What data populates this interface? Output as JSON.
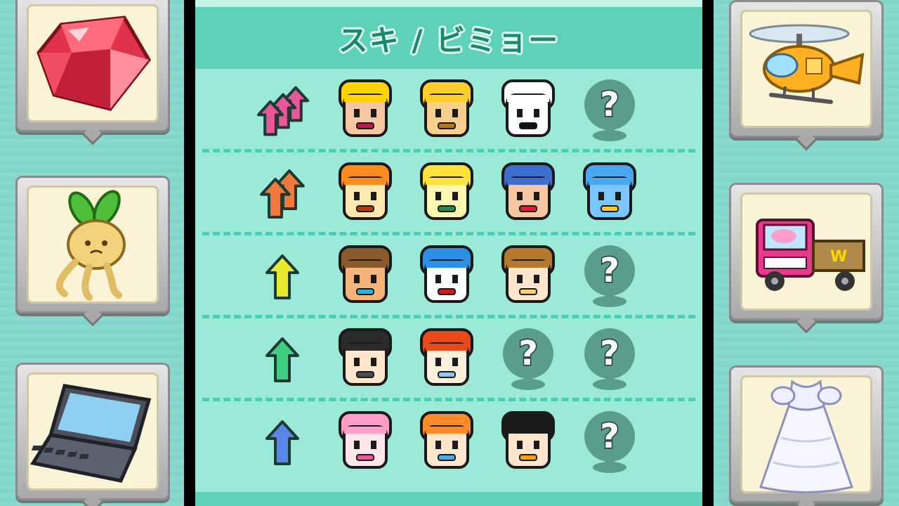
{
  "screen": {
    "title": "スキ / ビミョー"
  },
  "left_items": [
    {
      "icon": "red-gem-icon"
    },
    {
      "icon": "mandrake-root-icon"
    },
    {
      "icon": "laptop-icon"
    }
  ],
  "right_items": [
    {
      "icon": "yellow-helicopter-icon"
    },
    {
      "icon": "wario-truck-icon"
    },
    {
      "icon": "wedding-dress-icon"
    }
  ],
  "affinity_rows": [
    {
      "level": "triple-up",
      "arrow_color": "#e8579a",
      "slots": [
        "wario",
        "orange-helmet-bear",
        "white-rabbit-hand",
        "unknown"
      ]
    },
    {
      "level": "double-up",
      "arrow_color": "#f07a3e",
      "slots": [
        "orange-fox-mask",
        "yellow-cat",
        "red-visor-robot",
        "blue-robot"
      ]
    },
    {
      "level": "up",
      "arrow_color": "#e9ea2e",
      "slots": [
        "goggles-doctor",
        "blue-afro",
        "brown-hair-girl",
        "unknown"
      ]
    },
    {
      "level": "up",
      "arrow_color": "#3fce7f",
      "slots": [
        "spiky-hair-boy",
        "red-hood-girl",
        "unknown",
        "unknown"
      ]
    },
    {
      "level": "up",
      "arrow_color": "#5a86e8",
      "slots": [
        "pink-bun-girl",
        "orange-pigtail-girl",
        "black-hair-girl",
        "unknown"
      ]
    }
  ],
  "colors": {
    "panel_bg": "#9bead8",
    "header_bg": "#5dd2b8",
    "title": "#1a8a6c",
    "divider": "#4ccdb4",
    "unknown_badge": "#5a9d8b"
  }
}
